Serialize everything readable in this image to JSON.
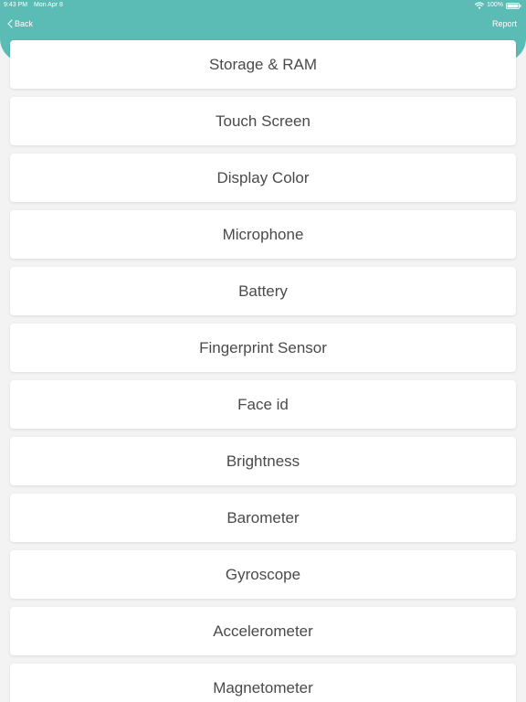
{
  "status_bar": {
    "time": "9:43 PM",
    "date": "Mon Apr 8",
    "battery": "100%",
    "icons": [
      "wifi-icon",
      "battery-icon"
    ]
  },
  "nav": {
    "back_label": "Back",
    "report_label": "Report",
    "back_icon": "chevron-left-icon"
  },
  "colors": {
    "header": "#5bbcb5",
    "background": "#f3f3f3",
    "card": "#ffffff",
    "text": "#4a4a4a"
  },
  "tests": [
    {
      "label": "Storage & RAM"
    },
    {
      "label": "Touch Screen"
    },
    {
      "label": "Display Color"
    },
    {
      "label": "Microphone"
    },
    {
      "label": "Battery"
    },
    {
      "label": "Fingerprint Sensor"
    },
    {
      "label": "Face id"
    },
    {
      "label": "Brightness"
    },
    {
      "label": "Barometer"
    },
    {
      "label": "Gyroscope"
    },
    {
      "label": "Accelerometer"
    },
    {
      "label": "Magnetometer"
    }
  ]
}
